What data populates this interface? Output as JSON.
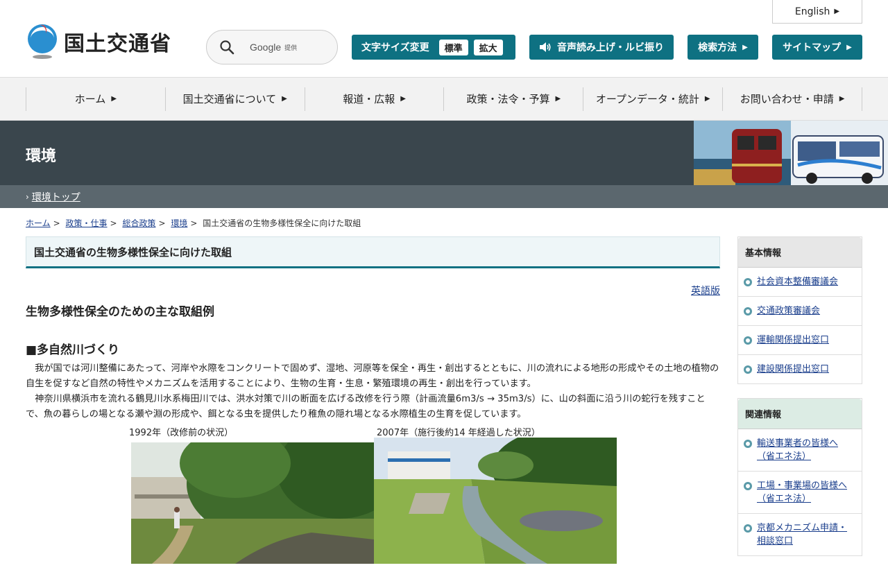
{
  "header": {
    "logo_text": "国土交通省",
    "search": {
      "brand": "Google",
      "provided": "提供"
    },
    "english": "English",
    "font_size": {
      "label": "文字サイズ変更",
      "standard": "標準",
      "large": "拡大"
    },
    "voice": "音声読み上げ・ルビ振り",
    "search_howto": "検索方法",
    "sitemap": "サイトマップ"
  },
  "gnav": [
    {
      "label": "ホーム"
    },
    {
      "label": "国土交通省について"
    },
    {
      "label": "報道・広報"
    },
    {
      "label": "政策・法令・予算"
    },
    {
      "label": "オープンデータ・統計"
    },
    {
      "label": "お問い合わせ・申請"
    }
  ],
  "banner": {
    "title": "環境",
    "subnav_link": "環境トップ"
  },
  "breadcrumb": [
    "ホーム",
    "政策・仕事",
    "総合政策",
    "環境",
    "国土交通省の生物多様性保全に向けた取組"
  ],
  "main": {
    "title": "国土交通省の生物多様性保全に向けた取組",
    "english_link": "英語版",
    "heading": "生物多様性保全のための主な取組例",
    "section_heading": "■多自然川づくり",
    "paragraph1": "我が国では河川整備にあたって、河岸や水際をコンクリートで固めず、湿地、河原等を保全・再生・創出するとともに、川の流れによる地形の形成やその土地の植物の自生を促すなど自然の特性やメカニズムを活用することにより、生物の生育・生息・繁殖環境の再生・創出を行っています。",
    "paragraph2": "神奈川県横浜市を流れる鶴見川水系梅田川では、洪水対策で川の断面を広げる改修を行う際（計画流量6m3/s → 35m3/s）に、山の斜面に沿う川の蛇行を残すことで、魚の暮らしの場となる瀬や淵の形成や、餌となる虫を提供したり稚魚の隠れ場となる水際植生の生育を促しています。",
    "caption_before": "1992年（改修前の状況）",
    "caption_after": "2007年（施行後約14 年経過した状況）"
  },
  "sidebar": {
    "basic": {
      "title": "基本情報",
      "items": [
        "社会資本整備審議会",
        "交通政策審議会",
        "運輸関係提出窓口",
        "建設関係提出窓口"
      ]
    },
    "related": {
      "title": "関連情報",
      "items": [
        "輸送事業者の皆様へ（省エネ法）",
        "工場・事業場の皆様へ（省エネ法）",
        "京都メカニズム申請・相談窓口"
      ]
    }
  },
  "colors": {
    "accent": "#0e7182",
    "banner": "#3a464d",
    "subnav": "#5b676e"
  }
}
